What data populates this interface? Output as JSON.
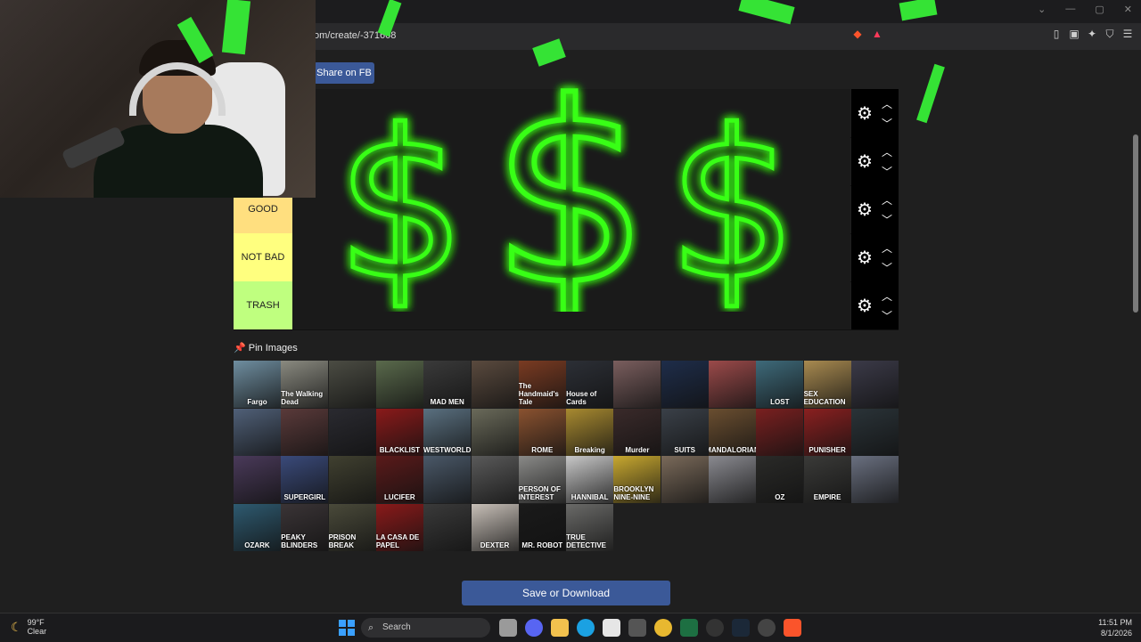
{
  "browser": {
    "address": "om/create/-371608"
  },
  "share_button": "Share on FB",
  "tiers": [
    {
      "label": "",
      "color": "#ff7f7f"
    },
    {
      "label": "",
      "color": "#ffbf7f"
    },
    {
      "label": "GOOD",
      "color": "#ffdf7f"
    },
    {
      "label": "NOT BAD",
      "color": "#ffff7f"
    },
    {
      "label": "TRASH",
      "color": "#bfff7f"
    }
  ],
  "pin_images": "Pin Images",
  "posters": [
    {
      "title": "Fargo",
      "color": "#6f8ea0"
    },
    {
      "title": "The Walking Dead",
      "color": "#8a8a80"
    },
    {
      "title": "",
      "color": "#4b4c43"
    },
    {
      "title": "",
      "color": "#5a6a4c"
    },
    {
      "title": "MAD MEN",
      "color": "#3a3a3a"
    },
    {
      "title": "",
      "color": "#5a4a3e"
    },
    {
      "title": "The Handmaid's Tale",
      "color": "#7a3b22"
    },
    {
      "title": "House of Cards",
      "color": "#2c2f36"
    },
    {
      "title": "",
      "color": "#7a5e5e"
    },
    {
      "title": "",
      "color": "#1e2d4a"
    },
    {
      "title": "",
      "color": "#9b4a4a"
    },
    {
      "title": "LOST",
      "color": "#3e6a7a"
    },
    {
      "title": "SEX EDUCATION",
      "color": "#a88a50"
    },
    {
      "title": "",
      "color": "#3b3a48"
    },
    {
      "title": "",
      "color": "#506078"
    },
    {
      "title": "",
      "color": "#5a3a3a"
    },
    {
      "title": "",
      "color": "#2a2a30"
    },
    {
      "title": "BLACKLIST",
      "color": "#8a1a1a"
    },
    {
      "title": "WESTWORLD",
      "color": "#5a7080"
    },
    {
      "title": "",
      "color": "#6a6a5a"
    },
    {
      "title": "ROME",
      "color": "#8a5230"
    },
    {
      "title": "Breaking",
      "color": "#a88a30"
    },
    {
      "title": "Murder",
      "color": "#3a2a2a"
    },
    {
      "title": "SUITS",
      "color": "#3a4048"
    },
    {
      "title": "MANDALORIAN",
      "color": "#6a4e30"
    },
    {
      "title": "",
      "color": "#7a2020"
    },
    {
      "title": "PUNISHER",
      "color": "#8a2020"
    },
    {
      "title": "",
      "color": "#2a3338"
    },
    {
      "title": "",
      "color": "#4a3a5a"
    },
    {
      "title": "SUPERGIRL",
      "color": "#3a4a7a"
    },
    {
      "title": "",
      "color": "#404030"
    },
    {
      "title": "LUCIFER",
      "color": "#5a1a1a"
    },
    {
      "title": "",
      "color": "#4a5868"
    },
    {
      "title": "",
      "color": "#5a5a5a"
    },
    {
      "title": "PERSON OF INTEREST",
      "color": "#8a8a88"
    },
    {
      "title": "HANNIBAL",
      "color": "#c8c8c8"
    },
    {
      "title": "BROOKLYN NINE-NINE",
      "color": "#c8a830"
    },
    {
      "title": "",
      "color": "#7a6a5a"
    },
    {
      "title": "",
      "color": "#8a8a90"
    },
    {
      "title": "OZ",
      "color": "#2a2a28"
    },
    {
      "title": "EMPIRE",
      "color": "#3a3a38"
    },
    {
      "title": "",
      "color": "#6a7080"
    },
    {
      "title": "OZARK",
      "color": "#2e5a70"
    },
    {
      "title": "PEAKY BLINDERS",
      "color": "#3a3436"
    },
    {
      "title": "PRISON BREAK",
      "color": "#4a4a3a"
    },
    {
      "title": "LA CASA DE PAPEL",
      "color": "#8a1a1a"
    },
    {
      "title": "",
      "color": "#3a3a3a"
    },
    {
      "title": "DEXTER",
      "color": "#c8c0b8"
    },
    {
      "title": "MR. ROBOT",
      "color": "#1a1a1a"
    },
    {
      "title": "TRUE DETECTIVE",
      "color": "#6a6a68"
    }
  ],
  "save_button": "Save or Download",
  "taskbar": {
    "temp": "99°F",
    "condition": "Clear",
    "search": "Search",
    "time": "11:51 PM",
    "date": "8/1/2026"
  },
  "colors": {
    "accent_blue": "#3b5998",
    "neon_green": "#39ff14"
  }
}
